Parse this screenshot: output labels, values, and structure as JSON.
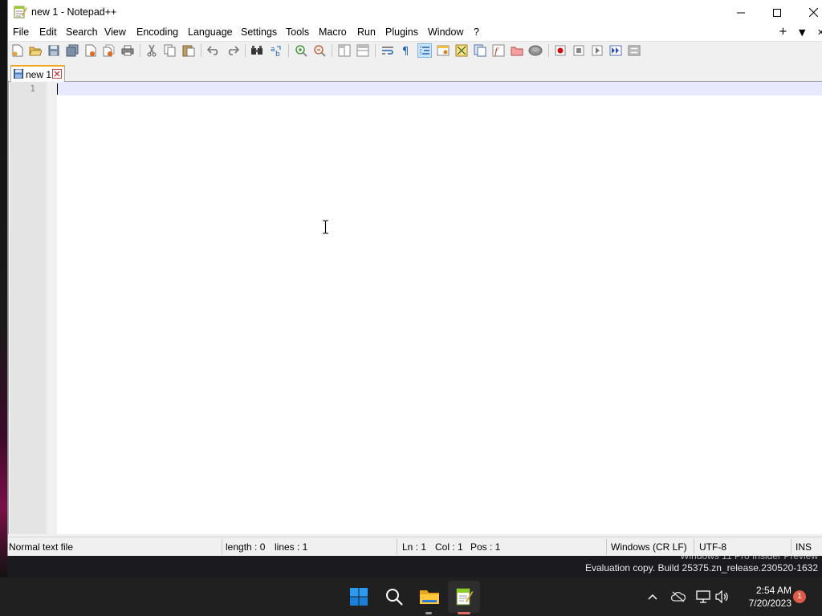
{
  "window": {
    "title": "new 1 - Notepad++",
    "minimize_glyph": "—",
    "maximize_glyph": "☐",
    "close_glyph": "✕"
  },
  "menu": {
    "items": [
      "File",
      "Edit",
      "Search",
      "View",
      "Encoding",
      "Language",
      "Settings",
      "Tools",
      "Macro",
      "Run",
      "Plugins",
      "Window",
      "?"
    ],
    "plus_glyph": "+",
    "dropdown_glyph": "▼",
    "close_glyph": "✕"
  },
  "toolbar": {
    "icons": [
      "new-file-icon",
      "open-file-icon",
      "save-icon",
      "save-all-icon",
      "close-icon",
      "close-all-icon",
      "print-icon",
      "cut-icon",
      "copy-icon",
      "paste-icon",
      "undo-icon",
      "redo-icon",
      "find-icon",
      "replace-icon",
      "zoom-in-icon",
      "zoom-out-icon",
      "sync-vertical-icon",
      "sync-horizontal-icon",
      "word-wrap-icon",
      "show-all-chars-icon",
      "indent-guide-icon",
      "udl-icon",
      "doc-map-icon",
      "doc-list-icon",
      "function-list-icon",
      "folder-workspace-icon",
      "monitoring-icon",
      "record-macro-icon",
      "stop-macro-icon",
      "play-macro-icon",
      "run-macro-multiple-icon",
      "save-macro-icon"
    ]
  },
  "tabs": [
    {
      "label": "new 1",
      "active": true
    }
  ],
  "editor": {
    "line_numbers": [
      "1"
    ],
    "content": ""
  },
  "statusbar": {
    "file_type": "Normal text file",
    "length": "length : 0",
    "lines": "lines : 1",
    "ln": "Ln : 1",
    "col": "Col : 1",
    "pos": "Pos : 1",
    "eol": "Windows (CR LF)",
    "encoding": "UTF-8",
    "mode": "INS"
  },
  "watermark": {
    "line1": "Windows 11 Pro Insider Preview",
    "line2": "Evaluation copy. Build 25375.zn_release.230520-1632"
  },
  "taskbar": {
    "time": "2:54 AM",
    "date": "7/20/2023",
    "notification_count": "1",
    "tray_chevron": "^"
  },
  "colors": {
    "accent_tab": "#f5a623",
    "current_line": "#e8e8ff",
    "taskbar_bg": "#202020",
    "windows_blue": "#0078d4"
  }
}
